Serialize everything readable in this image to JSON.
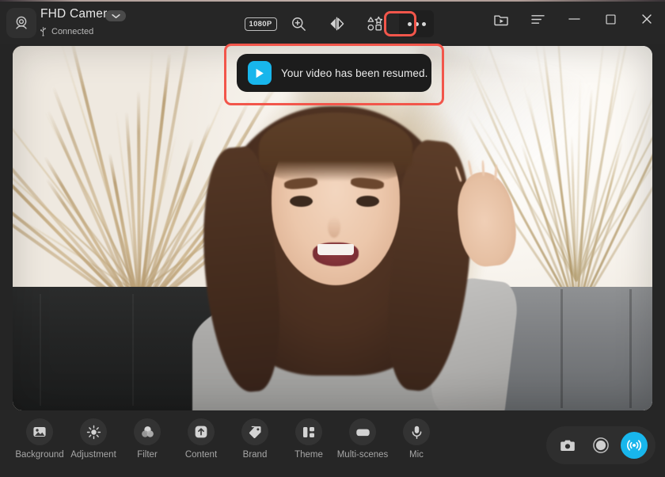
{
  "window": {
    "device_name": "FHD Camera",
    "connection_status": "Connected",
    "connection_icon": "usb-icon",
    "device_icon": "webcam-icon",
    "dropdown_icon": "chevron-down-icon",
    "accent_color": "#18b6ec",
    "highlight_color": "#f2564b",
    "background_color": "#262626"
  },
  "toolbar": {
    "resolution_label": "1080P",
    "items": [
      {
        "name": "resolution-button",
        "icon": "resolution-badge",
        "label": "1080P"
      },
      {
        "name": "zoom-button",
        "icon": "zoom-in-icon",
        "label": "Zoom"
      },
      {
        "name": "mirror-button",
        "icon": "mirror-flip-icon",
        "label": "Mirror"
      },
      {
        "name": "effects-button",
        "icon": "shapes-stickers-icon",
        "label": "Effects"
      },
      {
        "name": "more-button",
        "icon": "more-dots-icon",
        "label": "More"
      }
    ]
  },
  "window_controls": [
    {
      "name": "open-folder-button",
      "icon": "folder-video-icon",
      "label": "Files"
    },
    {
      "name": "menu-button",
      "icon": "hamburger-menu-icon",
      "label": "Menu"
    },
    {
      "name": "minimize-button",
      "icon": "minimize-icon",
      "label": "Minimize"
    },
    {
      "name": "maximize-button",
      "icon": "maximize-icon",
      "label": "Maximize"
    },
    {
      "name": "close-button",
      "icon": "close-icon",
      "label": "Close"
    }
  ],
  "toast": {
    "message": "Your video has been resumed.",
    "icon": "play-video-icon",
    "icon_color": "#18b6ec"
  },
  "preview": {
    "description": "Live webcam preview of a smiling woman in a grey hoodie waving, with dried pampas grass and a sofa in the background"
  },
  "bottom_tools": [
    {
      "label": "Background",
      "icon": "image-icon"
    },
    {
      "label": "Adjustment",
      "icon": "brightness-sun-icon"
    },
    {
      "label": "Filter",
      "icon": "color-circles-icon"
    },
    {
      "label": "Content",
      "icon": "upload-arrow-icon"
    },
    {
      "label": "Brand",
      "icon": "tag-icon"
    },
    {
      "label": "Theme",
      "icon": "layout-blocks-icon"
    },
    {
      "label": "Multi-scenes",
      "icon": "scene-card-icon"
    },
    {
      "label": "Mic",
      "icon": "microphone-icon"
    }
  ],
  "actions": [
    {
      "name": "snapshot-button",
      "icon": "camera-icon",
      "label": "Snapshot",
      "active": false
    },
    {
      "name": "record-button",
      "icon": "record-circle-icon",
      "label": "Record",
      "active": false
    },
    {
      "name": "live-stream-button",
      "icon": "broadcast-icon",
      "label": "Live",
      "active": true
    }
  ]
}
